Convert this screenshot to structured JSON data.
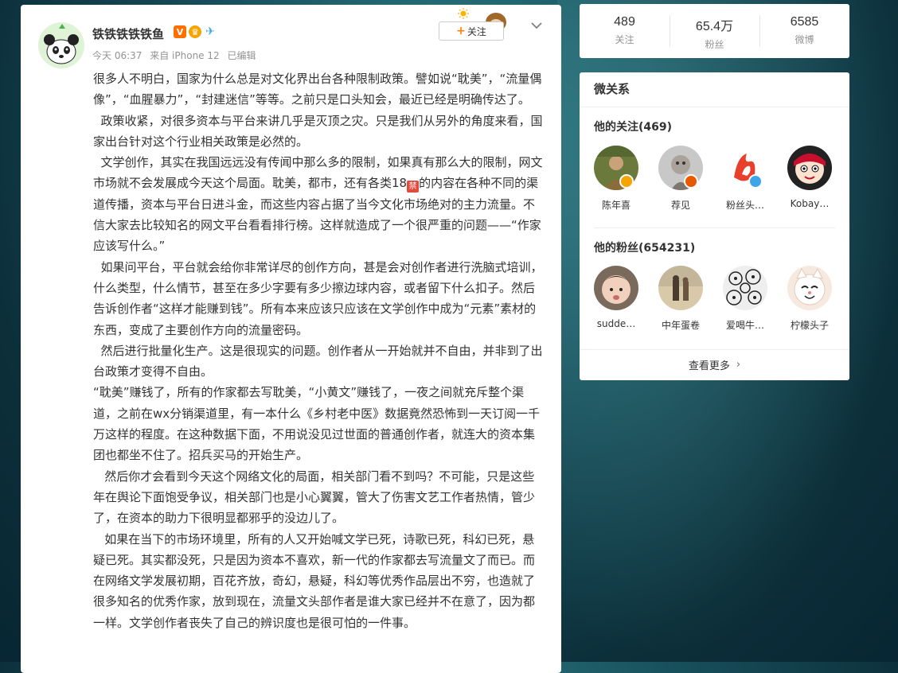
{
  "post": {
    "username": "铁铁铁铁铁鱼",
    "time": "今天 06:37",
    "source": "来自 iPhone 12",
    "edited": "已编辑",
    "follow_label": "关注",
    "paragraphs": [
      "很多人不明白，国家为什么总是对文化界出台各种限制政策。譬如说“耽美”，“流量偶像”，“血腥暴力”，“封建迷信”等等。之前只是口头知会，最近已经是明确传达了。",
      "  政策收紧，对很多资本与平台来讲几乎是灭顶之灾。只是我们从另外的角度来看，国家出台针对这个行业相关政策是必然的。",
      "  文学创作，其实在我国远远没有传闻中那么多的限制，如果真有那么大的限制，网文市场就不会发展成今天这个局面。耽美，都市，还有各类18",
      "的内容在各种不同的渠道传播，资本与平台日进斗金，而这些内容占据了当今文化市场绝对的主力流量。不信大家去比较知名的网文平台看看排行榜。这样就造成了一个很严重的问题——“作家应该写什么。”",
      "  如果问平台，平台就会给你非常详尽的创作方向，甚是会对创作者进行洗脑式培训，什么类型，什么情节，甚至在多少字要有多少擦边球内容，或者留下什么扣子。然后告诉创作者“这样才能赚到钱”。所有本来应该只应该在文学创作中成为“元素”素材的东西，变成了主要创作方向的流量密码。",
      "  然后进行批量化生产。这是很现实的问题。创作者从一开始就并不自由，并非到了出台政策才变得不自由。",
      "“耽美”赚钱了，所有的作家都去写耽美，“小黄文”赚钱了，一夜之间就充斥整个渠道，之前在wx分销渠道里，有一本什么《乡村老中医》数据竟然恐怖到一天订阅一千万这样的程度。在这种数据下面，不用说没见过世面的普通创作者，就连大的资本集团也都坐不住了。招兵买马的开始生产。",
      "   然后你才会看到今天这个网络文化的局面，相关部门看不到吗？不可能，只是这些年在舆论下面饱受争议，相关部门也是小心翼翼，管大了伤害文艺工作者热情，管少了，在资本的助力下很明显都邪乎的没边儿了。",
      "   如果在当下的市场环境里，所有的人又开始喊文学已死，诗歌已死，科幻已死，悬疑已死。其实都没死，只是因为资本不喜欢，新一代的作家都去写流量文了而已。而在网络文学发展初期，百花齐放，奇幻，悬疑，科幻等优秀作品层出不穷，也造就了很多知名的优秀作家，放到现在，流量文头部作者是谁大家已经并不在意了，因为都一样。文学创作者丧失了自己的辨识度也是很可怕的一件事。"
    ],
    "ban_emoji": "禁"
  },
  "stats": [
    {
      "num": "489",
      "label": "关注"
    },
    {
      "num": "65.4万",
      "label": "粉丝"
    },
    {
      "num": "6585",
      "label": "微博"
    }
  ],
  "relations": {
    "title": "微关系",
    "following_title": "他的关注(469)",
    "following": [
      {
        "name": "陈年喜",
        "badge_color": "#f5a400"
      },
      {
        "name": "荐见",
        "badge_color": "#e85a00"
      },
      {
        "name": "粉丝头…",
        "badge_color": "#3ea6e8"
      },
      {
        "name": "Kobay…",
        "badge_color": ""
      }
    ],
    "fans_title": "他的粉丝(654231)",
    "fans": [
      {
        "name": "sudde…"
      },
      {
        "name": "中年蛋卷"
      },
      {
        "name": "爱喝牛…"
      },
      {
        "name": "柠檬头子"
      }
    ],
    "more_label": "查看更多"
  },
  "colors": {
    "accent": "#ff8200",
    "verified_blue": "#3ea6e8"
  }
}
